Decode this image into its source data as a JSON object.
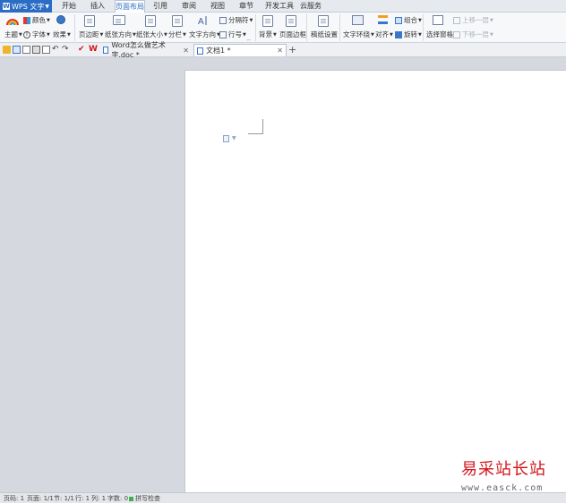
{
  "app": {
    "name": "WPS 文字",
    "logo_letter": "W"
  },
  "menu_tabs": [
    "开始",
    "插入",
    "页面布局",
    "引用",
    "审阅",
    "视图",
    "章节",
    "开发工具",
    "云服务"
  ],
  "active_menu_tab": "页面布局",
  "ribbon": {
    "theme": "主题",
    "colors": "颜色",
    "font": "字体",
    "effects": "效果",
    "margins": "页边距",
    "orientation": "纸张方向",
    "size": "纸张大小",
    "columns": "分栏",
    "text_direction": "文字方向",
    "breaks": "分隔符",
    "line_numbers": "行号",
    "background": "背景",
    "page_border": "页面边框",
    "page_setup": "稿纸设置",
    "wrap_text": "文字环绕",
    "align": "对齐",
    "group": "组合",
    "rotate": "旋转",
    "selection_pane": "选择窗格",
    "bring_forward": "上移一层",
    "send_backward": "下移一层"
  },
  "doc_tabs": [
    {
      "title": "Word怎么做艺术字.doc *"
    },
    {
      "title": "文档1 *"
    }
  ],
  "new_tab": "+",
  "status": {
    "page": "页码: 1",
    "pages": "页面: 1/1",
    "section": "节: 1/1",
    "row": "行: 1",
    "col": "列: 1",
    "words": "字数: 0",
    "spell": "拼写检查"
  },
  "watermark": {
    "cn": "易采站长站",
    "url": "www.easck.com"
  },
  "colors": {
    "accent": "#2b6cc4",
    "watermark_red": "#d2161c"
  }
}
